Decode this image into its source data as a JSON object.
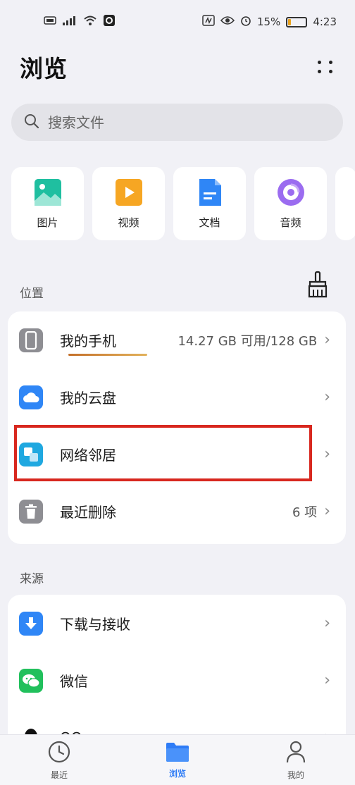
{
  "status_bar": {
    "battery_text": "15%",
    "time": "4:23",
    "battery_level": 0.15
  },
  "header": {
    "title": "浏览"
  },
  "search": {
    "placeholder": "搜索文件"
  },
  "categories": [
    {
      "label": "图片",
      "icon": "image-icon"
    },
    {
      "label": "视频",
      "icon": "video-icon"
    },
    {
      "label": "文档",
      "icon": "document-icon"
    },
    {
      "label": "音频",
      "icon": "audio-icon"
    }
  ],
  "locations": {
    "section_title": "位置",
    "items": [
      {
        "label": "我的手机",
        "detail": "14.27 GB 可用/128 GB",
        "icon": "phone-icon"
      },
      {
        "label": "我的云盘",
        "detail": "",
        "icon": "cloud-icon"
      },
      {
        "label": "网络邻居",
        "detail": "",
        "icon": "network-icon"
      },
      {
        "label": "最近删除",
        "detail": "6 项",
        "icon": "trash-icon"
      }
    ]
  },
  "sources": {
    "section_title": "来源",
    "items": [
      {
        "label": "下载与接收",
        "icon": "download-icon"
      },
      {
        "label": "微信",
        "icon": "wechat-icon"
      },
      {
        "label": "QQ",
        "icon": "qq-icon"
      }
    ]
  },
  "bottom_nav": [
    {
      "label": "最近",
      "icon": "clock-icon",
      "active": false
    },
    {
      "label": "浏览",
      "icon": "folder-icon",
      "active": true
    },
    {
      "label": "我的",
      "icon": "person-icon",
      "active": false
    }
  ],
  "colors": {
    "accent": "#2f7cf6",
    "highlight_border": "#d8281f",
    "background": "#f1f1f6"
  }
}
